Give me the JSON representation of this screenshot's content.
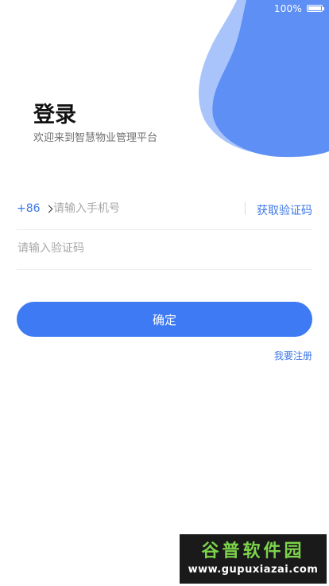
{
  "status_bar": {
    "battery_text": "100%"
  },
  "header": {
    "title": "登录",
    "subtitle": "欢迎来到智慧物业管理平台"
  },
  "phone": {
    "country_code": "+86",
    "placeholder": "请输入手机号",
    "get_code_label": "获取验证码"
  },
  "code": {
    "placeholder": "请输入验证码"
  },
  "confirm_label": "确定",
  "register_label": "我要注册",
  "watermark": {
    "top": "谷普软件园",
    "bottom": "www.gupuxiazai.com"
  },
  "colors": {
    "accent": "#3d7af3",
    "link": "#3d78e8",
    "decor_light": "#a9c4fb",
    "decor_dark": "#5e8ff5"
  }
}
